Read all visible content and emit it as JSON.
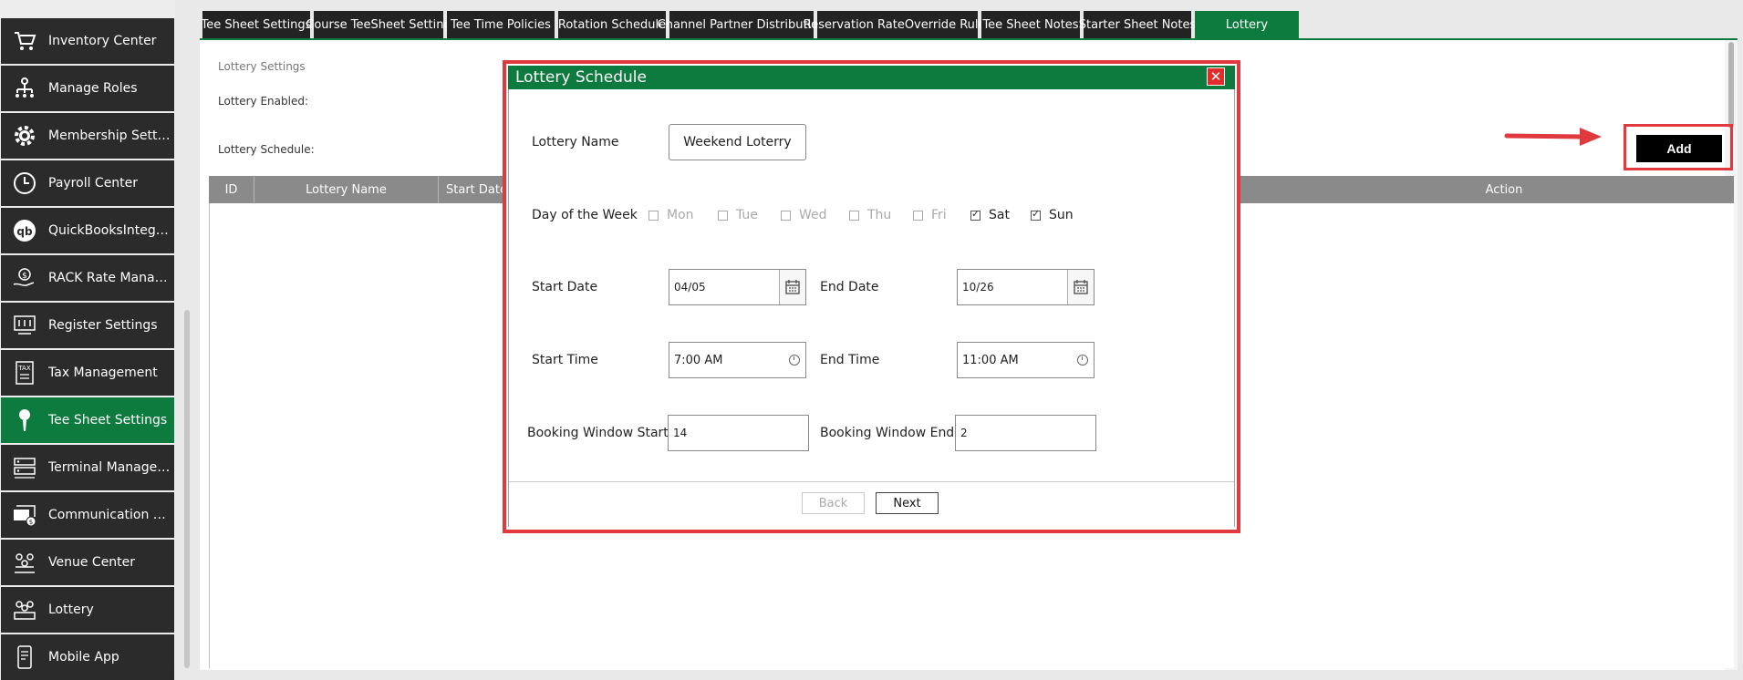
{
  "sidebar": {
    "items": [
      {
        "label": "Inventory Center",
        "icon": "cart-icon",
        "active": false
      },
      {
        "label": "Manage Roles",
        "icon": "hierarchy-icon",
        "active": false
      },
      {
        "label": "Membership Settings",
        "icon": "gear-icon",
        "active": false
      },
      {
        "label": "Payroll Center",
        "icon": "clock-icon",
        "active": false
      },
      {
        "label": "QuickBooksIntegration",
        "icon": "quickbooks-icon",
        "active": false
      },
      {
        "label": "RACK Rate Manageme...",
        "icon": "hand-dollar-icon",
        "active": false
      },
      {
        "label": "Register Settings",
        "icon": "register-icon",
        "active": false
      },
      {
        "label": "Tax Management",
        "icon": "tax-icon",
        "active": false
      },
      {
        "label": "Tee Sheet Settings",
        "icon": "golf-tee-icon",
        "active": true
      },
      {
        "label": "Terminal Management",
        "icon": "terminal-icon",
        "active": false
      },
      {
        "label": "Communication Center",
        "icon": "communication-icon",
        "active": false
      },
      {
        "label": "Venue Center",
        "icon": "venue-icon",
        "active": false
      },
      {
        "label": "Lottery",
        "icon": "lottery-icon",
        "active": false
      },
      {
        "label": "Mobile App",
        "icon": "mobile-app-icon",
        "active": false
      }
    ]
  },
  "tabs": [
    {
      "label": "Tee Sheet Settings",
      "active": false
    },
    {
      "label": "Course TeeSheet Setting",
      "active": false
    },
    {
      "label": "Tee Time Policies",
      "active": false
    },
    {
      "label": "Rotation Schedule",
      "active": false
    },
    {
      "label": "Channel Partner Distribution",
      "active": false
    },
    {
      "label": "Reservation RateOverride Rules",
      "active": false
    },
    {
      "label": "Tee Sheet Notes",
      "active": false
    },
    {
      "label": "Starter Sheet Notes",
      "active": false
    },
    {
      "label": "Lottery",
      "active": true
    }
  ],
  "main": {
    "section_title": "Lottery Settings",
    "enabled_label": "Lottery Enabled:",
    "schedule_label": "Lottery Schedule:",
    "add_label": "Add",
    "columns": [
      "ID",
      "Lottery Name",
      "Start Date",
      "Action"
    ]
  },
  "modal": {
    "title": "Lottery Schedule",
    "close_glyph": "✕",
    "lottery_name_label": "Lottery Name",
    "lottery_name_value": "Weekend Loterry",
    "day_label": "Day of the Week",
    "days": [
      {
        "label": "Mon",
        "checked": false
      },
      {
        "label": "Tue",
        "checked": false
      },
      {
        "label": "Wed",
        "checked": false
      },
      {
        "label": "Thu",
        "checked": false
      },
      {
        "label": "Fri",
        "checked": false
      },
      {
        "label": "Sat",
        "checked": true
      },
      {
        "label": "Sun",
        "checked": true
      }
    ],
    "start_date_label": "Start Date",
    "start_date_value": "04/05",
    "end_date_label": "End Date",
    "end_date_value": "10/26",
    "start_time_label": "Start Time",
    "start_time_value": "7:00 AM",
    "end_time_label": "End Time",
    "end_time_value": "11:00 AM",
    "bw_start_label": "Booking Window Start",
    "bw_start_value": "14",
    "bw_end_label": "Booking Window End",
    "bw_end_value": "2",
    "back_label": "Back",
    "next_label": "Next"
  },
  "colors": {
    "brand_green": "#0d7a3e",
    "sidebar_dark": "#2b2b2b",
    "highlight_red": "#e0393e"
  }
}
